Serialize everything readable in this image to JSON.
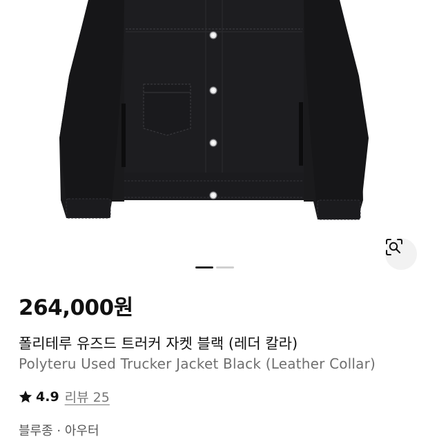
{
  "product": {
    "price": "264,000원",
    "name_ko": "폴리테루 유즈드 트러커 자켓 블랙 (레더 칼라)",
    "name_en": "Polyteru Used Trucker Jacket Black (Leather Collar)",
    "rating": "4.9",
    "reviews_label": "리뷰 25",
    "category": "블루종 · 아우터"
  },
  "gallery": {
    "current_index": 1,
    "total": 2
  },
  "colors": {
    "jacket": "#1a1a1c",
    "price_text": "#111111",
    "subtext": "#6f6f6f",
    "indicator_active": "#222222",
    "indicator_inactive": "#cfcfcf"
  },
  "icons": {
    "lens": "visual-search-icon",
    "star": "star-icon"
  }
}
